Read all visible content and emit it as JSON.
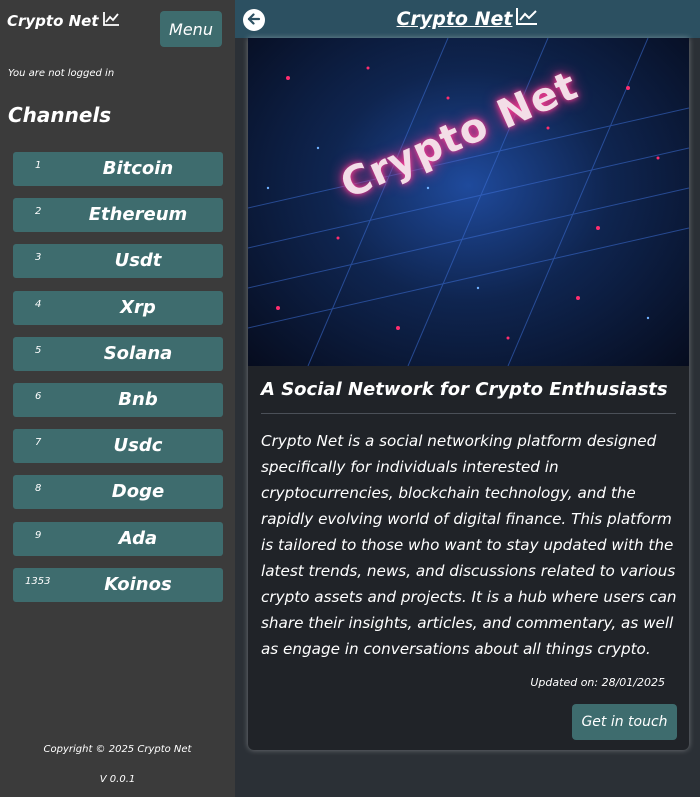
{
  "sidebar": {
    "brand": "Crypto Net",
    "menu_label": "Menu",
    "login_status": "You are not logged in",
    "channels_title": "Channels",
    "channels": [
      {
        "id": "1",
        "name": "Bitcoin"
      },
      {
        "id": "2",
        "name": "Ethereum"
      },
      {
        "id": "3",
        "name": "Usdt"
      },
      {
        "id": "4",
        "name": "Xrp"
      },
      {
        "id": "5",
        "name": "Solana"
      },
      {
        "id": "6",
        "name": "Bnb"
      },
      {
        "id": "7",
        "name": "Usdc"
      },
      {
        "id": "8",
        "name": "Doge"
      },
      {
        "id": "9",
        "name": "Ada"
      },
      {
        "id": "1353",
        "name": "Koinos"
      }
    ],
    "copyright": "Copyright © 2025 Crypto Net",
    "version": "V 0.0.1"
  },
  "topbar": {
    "title": "Crypto Net"
  },
  "card": {
    "hero_text": "Crypto Net",
    "title": "A Social Network for Crypto Enthusiasts",
    "description": "Crypto Net is a social networking platform designed specifically for individuals interested in cryptocurrencies, blockchain technology, and the rapidly evolving world of digital finance. This platform is tailored to those who want to stay updated with the latest trends, news, and discussions related to various crypto assets and projects. It is a hub where users can share their insights, articles, and commentary, as well as engage in conversations about all things crypto.",
    "updated": "Updated on: 28/01/2025",
    "contact_label": "Get in touch"
  },
  "colors": {
    "sidebar_bg": "#3b3b3b",
    "accent": "#3e6c6e",
    "topbar_bg": "#2c5061",
    "card_bg": "#202328"
  }
}
